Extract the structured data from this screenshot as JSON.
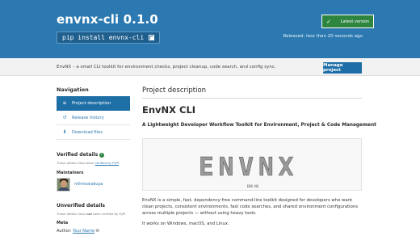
{
  "header": {
    "title": "envnx-cli 0.1.0",
    "pip_command": "pip install envnx-cli",
    "copy_icon": "copy-icon",
    "latest_label": "Latest version",
    "released": "Released: less than 20 seconds ago"
  },
  "summary": {
    "text": "EnvNX – a small CLI toolkit for environment checks, project cleanup, code search, and config sync.",
    "manage_label": "Manage project"
  },
  "nav": {
    "heading": "Navigation",
    "items": [
      {
        "label": "Project description",
        "icon": "align-left-icon"
      },
      {
        "label": "Release history",
        "icon": "history-icon"
      },
      {
        "label": "Download files",
        "icon": "download-icon"
      }
    ]
  },
  "verified": {
    "heading": "Verified details",
    "note": "These details have been",
    "note_link": "verified by PyPI",
    "maintainers_label": "Maintainers",
    "maintainer_name": "nithinsaiadupa"
  },
  "unverified": {
    "heading": "Unverified details",
    "note": "These details have",
    "note_not": "not",
    "note_tail": "been verified by PyPI"
  },
  "meta": {
    "heading": "Meta",
    "author_label": "Author:",
    "author_value": "Your Name"
  },
  "main": {
    "heading": "Project description",
    "readme_title": "EnvNX CLI",
    "readme_subtitle": "A Lightweight Developer Workflow Toolkit for Environment, Project & Code Management",
    "banner_text": "ENVNX",
    "banner_caption": "ENV-NX",
    "para1": "EnvNX is a simple, fast, dependency-free command-line toolkit designed for developers who want clean projects, consistent environments, fast code searches, and shared environment configurations across multiple projects — without using heavy tools.",
    "para2": "It works on Windows, macOS, and Linux."
  },
  "colors": {
    "hero": "#2c79b1",
    "latest_green": "#2e8540",
    "nav_active": "#1f6fa7",
    "link": "#2c79b1"
  }
}
